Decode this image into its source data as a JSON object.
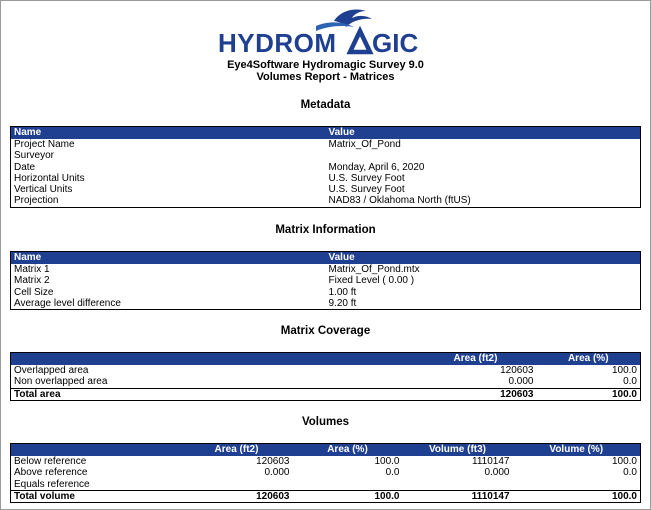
{
  "logo": {
    "text_left": "HYDROM",
    "text_right": "GIC",
    "color": "#1f3f91",
    "accent": "#2d63b3"
  },
  "header": {
    "title": "Eye4Software Hydromagic Survey 9.0",
    "subtitle": "Volumes Report - Matrices"
  },
  "colors": {
    "table_header": "#1f3f91"
  },
  "metadata": {
    "title": "Metadata",
    "columns": [
      "Name",
      "Value"
    ],
    "rows": [
      [
        "Project Name",
        "Matrix_Of_Pond"
      ],
      [
        "Surveyor",
        ""
      ],
      [
        "Date",
        "Monday, April 6, 2020"
      ],
      [
        "Horizontal Units",
        "U.S. Survey Foot"
      ],
      [
        "Vertical Units",
        "U.S. Survey Foot"
      ],
      [
        "Projection",
        "NAD83 / Oklahoma North (ftUS)"
      ]
    ]
  },
  "matrix_info": {
    "title": "Matrix Information",
    "columns": [
      "Name",
      "Value"
    ],
    "rows": [
      [
        "Matrix 1",
        "Matrix_Of_Pond.mtx"
      ],
      [
        "Matrix 2",
        "Fixed Level ( 0.00 )"
      ],
      [
        "Cell Size",
        "1.00 ft"
      ],
      [
        "Average level difference",
        "9.20 ft"
      ]
    ]
  },
  "coverage": {
    "title": "Matrix Coverage",
    "columns": [
      "",
      "Area (ft2)",
      "Area (%)"
    ],
    "rows": [
      [
        "Overlapped area",
        "120603",
        "100.0"
      ],
      [
        "Non overlapped area",
        "0.000",
        "0.0"
      ]
    ],
    "total": [
      "Total area",
      "120603",
      "100.0"
    ]
  },
  "volumes": {
    "title": "Volumes",
    "columns": [
      "",
      "Area (ft2)",
      "Area (%)",
      "Volume (ft3)",
      "Volume (%)"
    ],
    "rows": [
      [
        "Below reference",
        "120603",
        "100.0",
        "1110147",
        "100.0"
      ],
      [
        "Above reference",
        "0.000",
        "0.0",
        "0.000",
        "0.0"
      ],
      [
        "Equals reference",
        "",
        "",
        "",
        ""
      ]
    ],
    "total": [
      "Total volume",
      "120603",
      "100.0",
      "1110147",
      "100.0"
    ]
  }
}
